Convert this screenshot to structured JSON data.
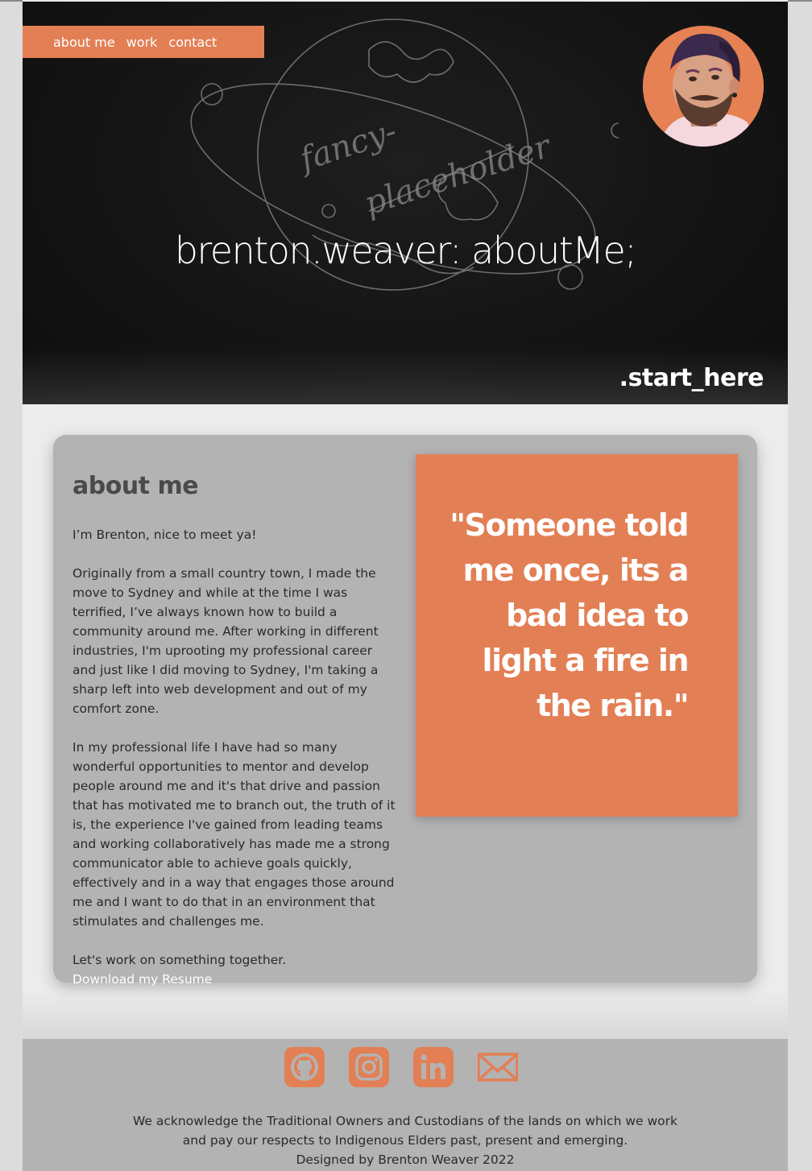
{
  "nav": {
    "items": [
      "about me",
      "work",
      "contact"
    ]
  },
  "hero": {
    "title": "brenton.weaver: aboutMe;",
    "art_text": [
      "fancy-",
      "placeholder"
    ],
    "cta": ".start_here"
  },
  "about": {
    "heading": "about me",
    "paragraphs": [
      "I’m Brenton, nice to meet ya!",
      "Originally from a small country town, I made the move to Sydney and while at the time I was terrified, I’ve always known how to build a community around me. After working in different industries, I'm uprooting my professional career and just like I did moving to Sydney, I'm taking a sharp left into web development and out of my comfort zone.",
      "In my professional life I have had so many wonderful opportunities to mentor and develop people around me and it's that drive and passion that has motivated me to branch out, the truth of it is, the experience I've gained from leading teams and working collaboratively has made me a strong communicator able to achieve goals quickly, effectively and in a way that engages those around me and I want to do that in an environment that stimulates and challenges me.",
      "Let's work on something together."
    ],
    "resume_link": "Download my Resume",
    "quote": "\"Someone told me once, its a bad idea to light a fire in the rain.\""
  },
  "footer": {
    "socials": [
      "github-icon",
      "instagram-icon",
      "linkedin-icon",
      "mail-icon"
    ],
    "acknowledgement_1": "We acknowledge the Traditional Owners and Custodians of the lands on which we work",
    "acknowledgement_2": "and pay our respects to Indigenous Elders past, present and emerging.",
    "credit": "Designed by Brenton Weaver 2022"
  },
  "colors": {
    "accent": "#e37f55",
    "card": "#b3b3b3",
    "hero_bg": "#141414"
  }
}
